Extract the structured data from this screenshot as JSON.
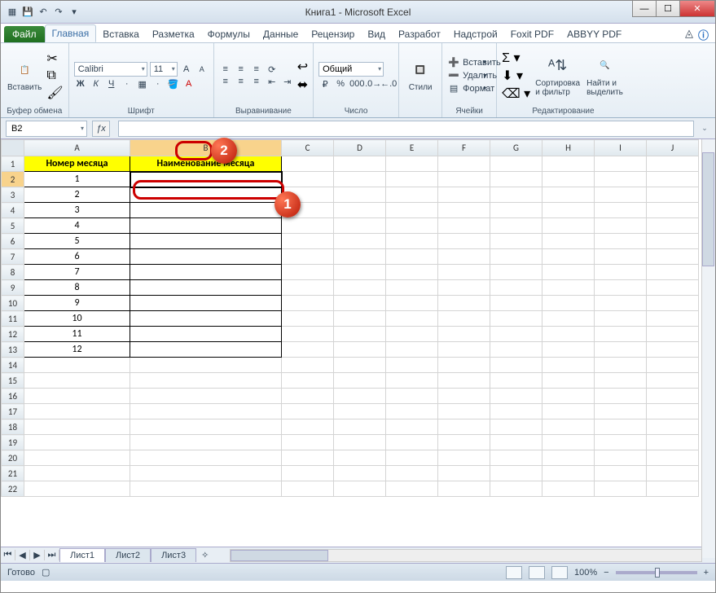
{
  "title": "Книга1  -  Microsoft Excel",
  "tabs": {
    "file": "Файл",
    "items": [
      "Главная",
      "Вставка",
      "Разметка",
      "Формулы",
      "Данные",
      "Рецензир",
      "Вид",
      "Разработ",
      "Надстрой",
      "Foxit PDF",
      "ABBYY PDF"
    ],
    "active_index": 0
  },
  "ribbon": {
    "clipboard": {
      "paste": "Вставить",
      "label": "Буфер обмена"
    },
    "font": {
      "name": "Calibri",
      "size": "11",
      "label": "Шрифт"
    },
    "alignment": {
      "label": "Выравнивание"
    },
    "number": {
      "format": "Общий",
      "label": "Число"
    },
    "styles": {
      "button": "Стили",
      "label": ""
    },
    "cells": {
      "insert": "Вставить",
      "delete": "Удалить",
      "format": "Формат",
      "label": "Ячейки"
    },
    "editing": {
      "sort": "Сортировка\nи фильтр",
      "find": "Найти и\nвыделить",
      "label": "Редактирование"
    }
  },
  "namebox": "B2",
  "formula": "",
  "columns": [
    "A",
    "B",
    "C",
    "D",
    "E",
    "F",
    "G",
    "H",
    "I",
    "J"
  ],
  "rows_visible": 22,
  "headers": {
    "A": "Номер месяца",
    "B": "Наименование месяца"
  },
  "col_a_values": [
    "1",
    "2",
    "3",
    "4",
    "5",
    "6",
    "7",
    "8",
    "9",
    "10",
    "11",
    "12"
  ],
  "selected_cell": "B2",
  "sheets": [
    "Лист1",
    "Лист2",
    "Лист3"
  ],
  "active_sheet": 0,
  "status_text": "Готово",
  "zoom": "100%",
  "callouts": {
    "1": "1",
    "2": "2"
  }
}
